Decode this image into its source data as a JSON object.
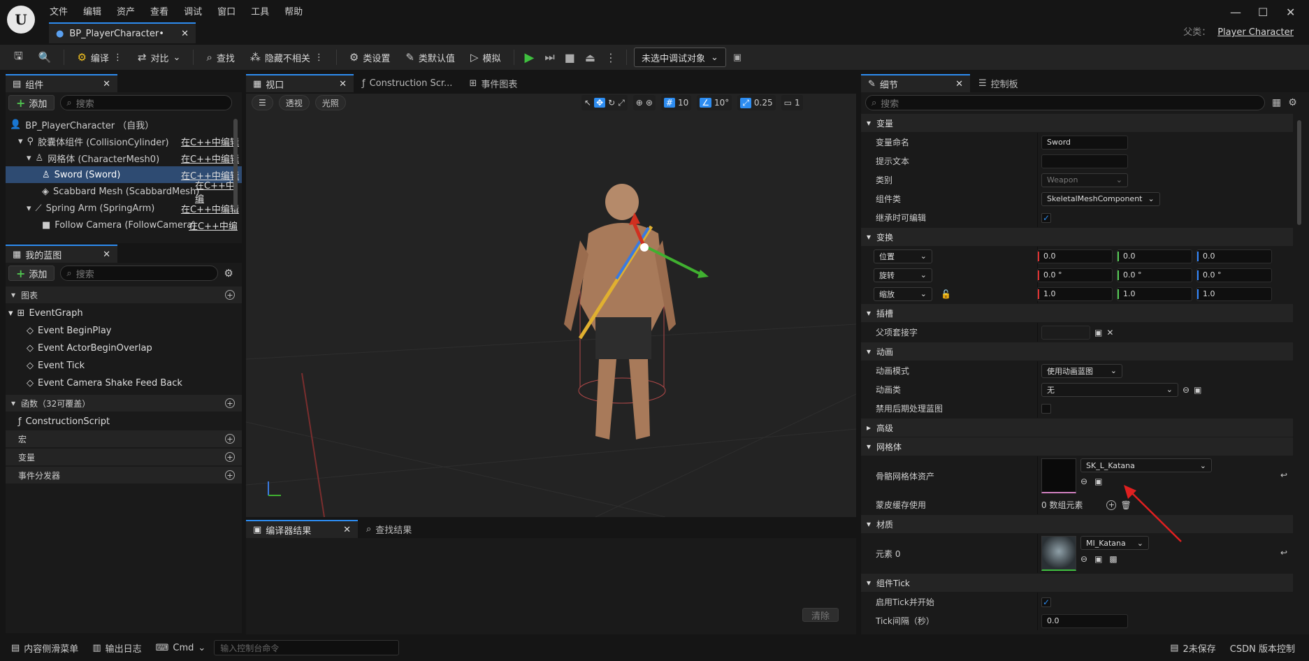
{
  "menu": [
    "文件",
    "编辑",
    "资产",
    "查看",
    "调试",
    "窗口",
    "工具",
    "帮助"
  ],
  "doc_tab": "BP_PlayerCharacter•",
  "parent_label": "父类：",
  "parent_value": "Player Character",
  "toolbar": {
    "compile": "编译",
    "diff": "对比",
    "find": "查找",
    "hide": "隐藏不相关",
    "class_settings": "类设置",
    "class_defaults": "类默认值",
    "simulate": "模拟",
    "debug_target": "未选中调试对象"
  },
  "components": {
    "tab": "组件",
    "add": "添加",
    "search_placeholder": "搜索",
    "items": [
      {
        "label": "BP_PlayerCharacter （自我）",
        "edit": ""
      },
      {
        "label": "胶囊体组件 (CollisionCylinder)",
        "edit": "在C++中编辑"
      },
      {
        "label": "网格体 (CharacterMesh0)",
        "edit": "在C++中编辑"
      },
      {
        "label": "Sword (Sword)",
        "edit": "在C++中编辑"
      },
      {
        "label": "Scabbard Mesh (ScabbardMesh)",
        "edit": "在C++中编"
      },
      {
        "label": "Spring Arm (SpringArm)",
        "edit": "在C++中编辑"
      },
      {
        "label": "Follow Camera (FollowCamera)",
        "edit": "在C++中编"
      }
    ]
  },
  "my_blueprint": {
    "tab": "我的蓝图",
    "add": "添加",
    "search_placeholder": "搜索",
    "graphs_label": "图表",
    "event_graph": "EventGraph",
    "events": [
      "Event BeginPlay",
      "Event ActorBeginOverlap",
      "Event Tick",
      "Event Camera Shake Feed Back"
    ],
    "functions_label": "函数（32可覆盖）",
    "construction": "ConstructionScript",
    "macros": "宏",
    "variables": "变量",
    "dispatchers": "事件分发器"
  },
  "viewport": {
    "tabs": [
      "视口",
      "Construction Scr...",
      "事件图表"
    ],
    "perspective": "透视",
    "lighting": "光照",
    "grid": "10",
    "angle": "10°",
    "scale": "0.25",
    "camera": "1"
  },
  "compiler": {
    "tab": "编译器结果",
    "find_tab": "查找结果",
    "clear": "清除"
  },
  "details": {
    "tab": "细节",
    "tab2": "控制板",
    "search_placeholder": "搜索",
    "sections": {
      "variable": "变量",
      "transform": "变换",
      "socket": "插槽",
      "animation": "动画",
      "advanced": "高级",
      "mesh": "网格体",
      "material": "材质",
      "tick": "组件Tick"
    },
    "var_name_label": "变量命名",
    "var_name": "Sword",
    "tooltip_label": "提示文本",
    "category_label": "类别",
    "category": "Weapon",
    "comp_class_label": "组件类",
    "comp_class": "SkeletalMeshComponent",
    "editable_label": "继承时可编辑",
    "location": "位置",
    "rotation": "旋转",
    "scale": "缩放",
    "loc": [
      "0.0",
      "0.0",
      "0.0"
    ],
    "rot": [
      "0.0 °",
      "0.0 °",
      "0.0 °"
    ],
    "scl": [
      "1.0",
      "1.0",
      "1.0"
    ],
    "parent_socket_label": "父项套接字",
    "anim_mode_label": "动画模式",
    "anim_mode": "使用动画蓝图",
    "anim_class_label": "动画类",
    "anim_class": "无",
    "disable_post_label": "禁用后期处理蓝图",
    "skel_mesh_label": "骨骼网格体资产",
    "skel_mesh": "SK_L_Katana",
    "skin_cache_label": "蒙皮缓存使用",
    "skin_cache": "0 数组元素",
    "element0_label": "元素 0",
    "element0": "MI_Katana",
    "tick_start_label": "启用Tick并开始",
    "tick_interval_label": "Tick间隔（秒）",
    "tick_interval": "0.0"
  },
  "status": {
    "drawer": "内容侧滑菜单",
    "log": "输出日志",
    "cmd": "Cmd",
    "cmd_placeholder": "输入控制台命令",
    "unsaved": "2未保存",
    "watermark": "CSDN 版本控制"
  }
}
